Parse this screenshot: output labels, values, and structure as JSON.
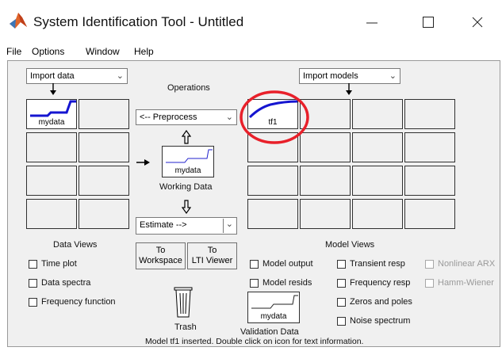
{
  "window": {
    "title": "System Identification Tool - Untitled"
  },
  "menu": {
    "items": [
      "File",
      "Options",
      "Window",
      "Help"
    ]
  },
  "left": {
    "import_data": "Import data",
    "tiles": [
      {
        "label": "mydata"
      }
    ],
    "data_views_title": "Data Views",
    "data_views": [
      "Time plot",
      "Data spectra",
      "Frequency function"
    ]
  },
  "center": {
    "operations_title": "Operations",
    "preprocess": "<-- Preprocess",
    "working_data_tile_label": "mydata",
    "working_data_caption": "Working Data",
    "estimate": "Estimate -->",
    "to_workspace": [
      "To",
      "Workspace"
    ],
    "to_ltiviewer": [
      "To",
      "LTI Viewer"
    ],
    "trash_label": "Trash"
  },
  "right": {
    "import_models": "Import models",
    "tiles": [
      {
        "label": "tf1"
      }
    ],
    "model_views_title": "Model Views",
    "model_views_col1": [
      "Model output",
      "Model resids"
    ],
    "model_views_col2": [
      "Transient resp",
      "Frequency resp",
      "Zeros and poles",
      "Noise spectrum"
    ],
    "model_views_col3": [
      "Nonlinear ARX",
      "Hamm-Wiener"
    ],
    "validation_tile_label": "mydata",
    "validation_caption": "Validation Data"
  },
  "status": {
    "text": "Model tf1 inserted. Double click on icon for text information."
  },
  "colors": {
    "curve_blue": "#1515d0",
    "highlight_red": "#e8202a",
    "disabled_text": "#9a9a9a"
  }
}
